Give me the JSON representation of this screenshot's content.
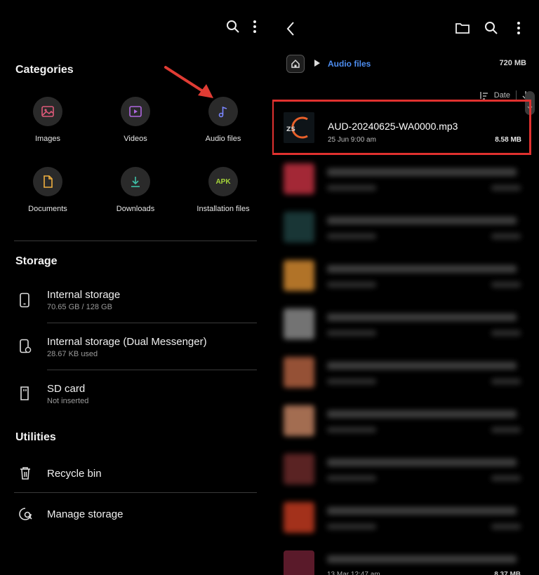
{
  "left": {
    "categories_title": "Categories",
    "categories": [
      {
        "label": "Images",
        "icon": "image-icon",
        "color": "#e05a7a"
      },
      {
        "label": "Videos",
        "icon": "video-icon",
        "color": "#b067e0"
      },
      {
        "label": "Audio files",
        "icon": "music-note-icon",
        "color": "#7a86ff"
      },
      {
        "label": "Documents",
        "icon": "document-icon",
        "color": "#f0b040"
      },
      {
        "label": "Downloads",
        "icon": "download-icon",
        "color": "#3fc0a8"
      },
      {
        "label": "Installation files",
        "icon": "apk-icon",
        "icon_text": "APK",
        "color": "#a6d63a"
      }
    ],
    "storage_title": "Storage",
    "storage": [
      {
        "title": "Internal storage",
        "sub": "70.65 GB / 128 GB",
        "icon": "phone-icon"
      },
      {
        "title": "Internal storage (Dual Messenger)",
        "sub": "28.67 KB used",
        "icon": "phone-shield-icon"
      },
      {
        "title": "SD card",
        "sub": "Not inserted",
        "icon": "sd-card-icon"
      }
    ],
    "utilities_title": "Utilities",
    "utilities": [
      {
        "title": "Recycle bin",
        "icon": "trash-icon"
      },
      {
        "title": "Manage storage",
        "icon": "manage-storage-icon"
      }
    ]
  },
  "right": {
    "breadcrumb_path": "Audio files",
    "folder_size": "720 MB",
    "sort_label": "Date",
    "highlighted_file": {
      "name": "AUD-20240625-WA0000.mp3",
      "date": "25 Jun 9:00 am",
      "size": "8.58 MB",
      "thumb_text": "ZS"
    },
    "blurred_files": [
      {
        "name": "",
        "date": "",
        "size": "",
        "color": "#c03040"
      },
      {
        "name": "",
        "date": "",
        "size": "",
        "color": "#1e4040"
      },
      {
        "name": "",
        "date": "",
        "size": "",
        "color": "#d08830"
      },
      {
        "name": "",
        "date": "",
        "size": "",
        "color": "#888888"
      },
      {
        "name": "",
        "date": "",
        "size": "",
        "color": "#b06040"
      },
      {
        "name": "",
        "date": "",
        "size": "",
        "color": "#c08060"
      },
      {
        "name": "",
        "date": "",
        "size": "",
        "color": "#6a2a2a"
      },
      {
        "name": "",
        "date": "",
        "size": "",
        "color": "#c03a20"
      },
      {
        "name": "",
        "date": "13 Mar 12:47 am",
        "size": "8.37 MB",
        "color": "#5a1a2a"
      }
    ]
  },
  "colors": {
    "highlight": "#e0312f",
    "arrow": "#e03c34",
    "link": "#4d8df0"
  }
}
